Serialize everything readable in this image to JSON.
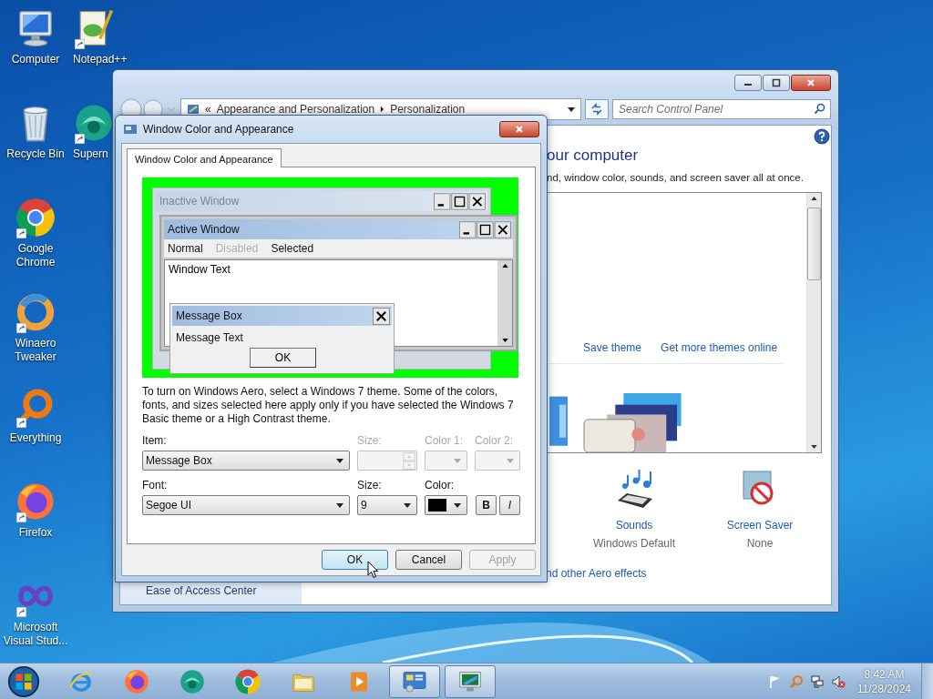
{
  "desktop": {
    "columns": [
      [
        {
          "label": "Computer",
          "kind": "computer",
          "shortcut": false
        },
        {
          "label": "Recycle Bin",
          "kind": "recycle",
          "shortcut": false
        },
        {
          "label": "Google Chrome",
          "kind": "chrome",
          "shortcut": true
        },
        {
          "label": "Winaero Tweaker",
          "kind": "winaero",
          "shortcut": true
        },
        {
          "label": "Everything",
          "kind": "everything",
          "shortcut": true
        },
        {
          "label": "Firefox",
          "kind": "firefox",
          "shortcut": true
        },
        {
          "label": "Microsoft Visual Stud...",
          "kind": "vs",
          "shortcut": true
        }
      ],
      [
        {
          "label": "Notepad++",
          "kind": "notepad",
          "shortcut": true
        },
        {
          "label": "Supern",
          "kind": "supern",
          "shortcut": true
        }
      ]
    ]
  },
  "control_panel": {
    "overflow": "«",
    "address": [
      "Appearance and Personalization",
      "Personalization"
    ],
    "search": {
      "placeholder": "Search Control Panel"
    },
    "heading": "our computer",
    "subtitle": "nd, window color, sounds, and screen saver all at once.",
    "theme_links": [
      "Save theme",
      "Get more themes online"
    ],
    "settings": [
      {
        "label": "Sounds",
        "value": "Windows Default",
        "kind": "sounds"
      },
      {
        "label": "Screen Saver",
        "value": "None",
        "kind": "screensaver"
      }
    ],
    "aero_link": "nd other Aero effects",
    "sidebar_link": "Ease of Access Center"
  },
  "dialog": {
    "title": "Window Color and Appearance",
    "tabs": [
      {
        "label": "Window Color and Appearance",
        "selected": true
      }
    ],
    "preview": {
      "inactive_title": "Inactive Window",
      "active_title": "Active Window",
      "menu": [
        {
          "label": "Normal",
          "disabled": false
        },
        {
          "label": "Disabled",
          "disabled": true
        },
        {
          "label": "Selected",
          "disabled": false
        }
      ],
      "window_text": "Window Text",
      "message_title": "Message Box",
      "message_text": "Message Text",
      "message_button": "OK"
    },
    "description": "To turn on Windows Aero, select a Windows 7 theme.  Some of the colors, fonts, and sizes selected here apply only if you have selected the Windows 7 Basic theme or a High Contrast theme.",
    "item_row": [
      {
        "label": "Item:",
        "value": "Message Box",
        "kind": "select",
        "disabled": false
      },
      {
        "label": "Size:",
        "kind": "spinner",
        "disabled": true
      },
      {
        "label": "Color 1:",
        "kind": "color",
        "disabled": true
      },
      {
        "label": "Color 2:",
        "kind": "color",
        "disabled": true
      }
    ],
    "font_row": [
      {
        "label": "Font:",
        "value": "Segoe UI",
        "kind": "select",
        "disabled": false
      },
      {
        "label": "Size:",
        "value": "9",
        "kind": "select",
        "disabled": false
      },
      {
        "label": "Color:",
        "kind": "color",
        "disabled": false,
        "color": "#000000"
      }
    ],
    "style_buttons": [
      {
        "label": "B",
        "kind": "bold"
      },
      {
        "label": "I",
        "kind": "italic"
      }
    ],
    "buttons": [
      {
        "label": "OK",
        "disabled": false,
        "focused": true
      },
      {
        "label": "Cancel",
        "disabled": false,
        "focused": false
      },
      {
        "label": "Apply",
        "disabled": true,
        "focused": false
      }
    ]
  },
  "taskbar": {
    "items": [
      {
        "kind": "ie",
        "active": false
      },
      {
        "kind": "firefox",
        "active": false
      },
      {
        "kind": "supern",
        "active": false
      },
      {
        "kind": "chrome",
        "active": false
      },
      {
        "kind": "explorer",
        "active": false
      },
      {
        "kind": "media",
        "active": false
      },
      {
        "kind": "controlpanel",
        "active": true
      },
      {
        "kind": "display",
        "active": true
      }
    ],
    "time": "8:42 AM",
    "date": "11/28/2024"
  }
}
